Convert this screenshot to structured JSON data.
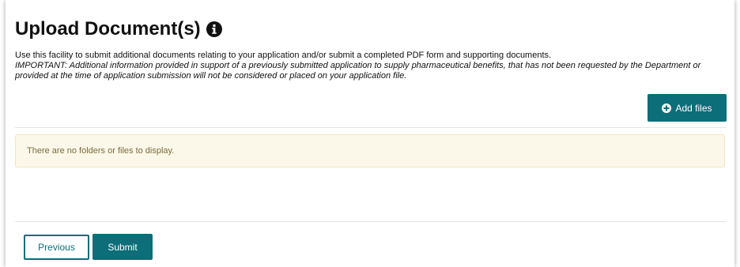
{
  "page": {
    "title": "Upload Document(s)",
    "description": "Use this facility to submit additional documents relating to your application and/or submit a completed PDF form and supporting documents.",
    "important": "IMPORTANT: Additional information provided in support of a previously submitted application to supply pharmaceutical benefits, that has not been requested by the Department or provided at the time of application submission will not be considered or placed on your application file."
  },
  "files": {
    "add_label": "Add files",
    "empty_message": "There are no folders or files to display."
  },
  "footer": {
    "previous_label": "Previous",
    "submit_label": "Submit"
  },
  "icons": {
    "title_info": "info-circle-icon",
    "add": "plus-circle-icon"
  },
  "colors": {
    "accent": "#0b6e78",
    "warning_bg": "#fcf8e9",
    "warning_text": "#7a6a3d"
  }
}
